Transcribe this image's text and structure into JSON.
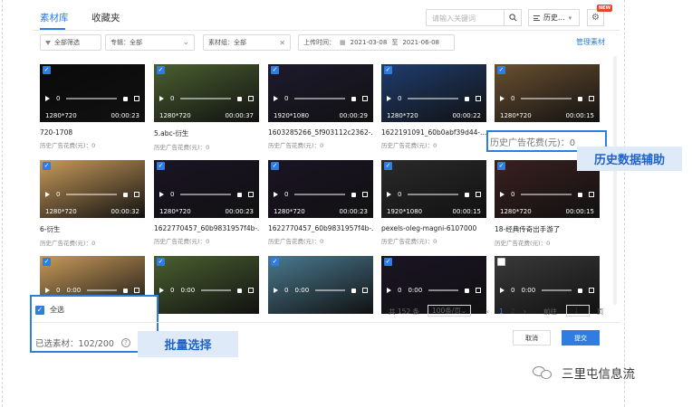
{
  "tabs": [
    {
      "label": "素材库",
      "active": true
    },
    {
      "label": "收藏夹",
      "active": false
    }
  ],
  "search": {
    "placeholder": "请输入关键词"
  },
  "history_button": {
    "label": "历史..."
  },
  "new_badge": "NEW",
  "filters": {
    "all_filter": "全部筛选",
    "album": "专辑：全部",
    "group": "素材组：全部",
    "upload_time_label": "上传时间：",
    "date_from": "2021-03-08",
    "date_sep": "至",
    "date_to": "2021-06-08"
  },
  "manage_link": "管理素材",
  "materials": [
    {
      "name": "720-1708",
      "spend": "历史广告花费(元)：0",
      "res": "1280*720",
      "dur": "00:00:23",
      "vol": "0",
      "checked": true,
      "bg": "#0a0a0a"
    },
    {
      "name": "5.abc-衍生",
      "spend": "历史广告花费(元)：0",
      "res": "1280*720",
      "dur": "00:00:37",
      "vol": "0",
      "checked": true,
      "bg": "#4a6030"
    },
    {
      "name": "1603285266_5f903112c2362-...",
      "spend": "历史广告花费(元)：0",
      "res": "1920*1080",
      "dur": "00:00:29",
      "vol": "0",
      "checked": true,
      "bg": "#1e1a2e"
    },
    {
      "name": "1622191091_60b0abf39d44-...",
      "spend": "历史广告花费(元)：0",
      "res": "1280*720",
      "dur": "00:00:22",
      "vol": "0",
      "checked": true,
      "bg": "#1f3d6e"
    },
    {
      "name": "",
      "spend": "",
      "res": "1280*720",
      "dur": "00:00:15",
      "vol": "0",
      "checked": true,
      "bg": "#6a5030"
    },
    {
      "name": "6-衍生",
      "spend": "历史广告花费(元)：0",
      "res": "1280*720",
      "dur": "00:00:32",
      "vol": "0",
      "checked": true,
      "bg": "#c89a5a"
    },
    {
      "name": "1622770457_60b9831957f4b-...",
      "spend": "历史广告花费(元)：0",
      "res": "1280*720",
      "dur": "00:00:23",
      "vol": "0",
      "checked": true,
      "bg": "#1a1424"
    },
    {
      "name": "1622770457_60b9831957f4b-...",
      "spend": "历史广告花费(元)：0",
      "res": "1280*720",
      "dur": "00:00:23",
      "vol": "0",
      "checked": true,
      "bg": "#1a1424"
    },
    {
      "name": "pexels-oleg-magni-6107000",
      "spend": "历史广告花费(元)：0",
      "res": "1920*1080",
      "dur": "00:00:15",
      "vol": "0",
      "checked": true,
      "bg": "#2a2a2a"
    },
    {
      "name": "18-经典传奇出手游了",
      "spend": "历史广告花费(元)：0",
      "res": "1280*720",
      "dur": "00:00:15",
      "vol": "0",
      "checked": true,
      "bg": "#3a2020"
    },
    {
      "name": "",
      "spend": "",
      "res": "",
      "dur": "",
      "vol": "0",
      "time": "0:00",
      "checked": true,
      "bg": "#c89a5a"
    },
    {
      "name": "",
      "spend": "",
      "res": "",
      "dur": "",
      "vol": "0",
      "time": "0:00",
      "checked": true,
      "bg": "#4a6030"
    },
    {
      "name": "",
      "spend": "",
      "res": "",
      "dur": "",
      "vol": "0",
      "time": "0:00",
      "checked": true,
      "bg": "#4a7a90"
    },
    {
      "name": "",
      "spend": "",
      "res": "",
      "dur": "",
      "vol": "0",
      "time": "0:00",
      "checked": true,
      "bg": "#1a1424"
    },
    {
      "name": "",
      "spend": "",
      "res": "",
      "dur": "",
      "vol": "0",
      "time": "0:00",
      "checked": false,
      "bg": "#3a3a3a"
    }
  ],
  "callout_spend": "历史广告花费(元)：0",
  "label_history": "历史数据辅助",
  "select_all": "全选",
  "selected_count": "已选素材：102/200",
  "label_batch": "批量选择",
  "pagination": {
    "total": "共 152 条",
    "page_size": "100条/页",
    "pages": [
      "1",
      "2"
    ],
    "goto_label": "前往",
    "goto_value": "1",
    "page_unit": "页"
  },
  "buttons": {
    "cancel": "取消",
    "submit": "提交"
  },
  "watermark": "三里屯信息流",
  "colors": {
    "accent": "#2f7de1",
    "label_bg": "#dfeaf8",
    "label_text": "#1f64c4"
  }
}
